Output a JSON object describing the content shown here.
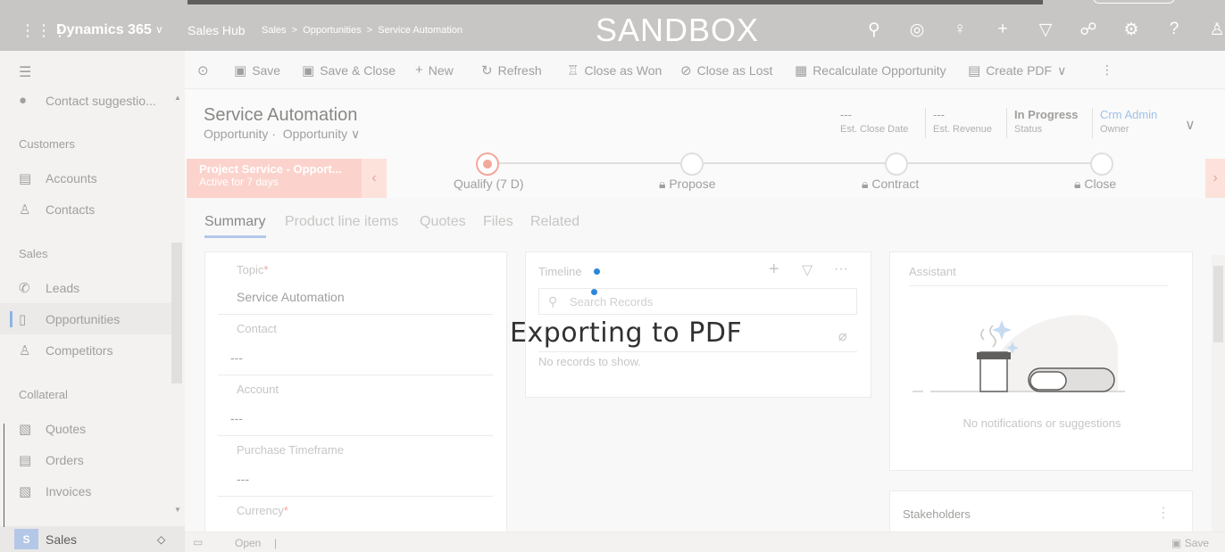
{
  "topbar": {
    "app_name": "Dynamics 365",
    "hub": "Sales Hub",
    "breadcrumb": [
      "Sales",
      "Opportunities",
      "Service Automation"
    ],
    "environment": "SANDBOX",
    "icons": [
      "search-icon",
      "task-icon",
      "lightbulb-icon",
      "plus-icon",
      "filter-icon",
      "assistant-icon",
      "gear-icon",
      "help-icon",
      "user-icon"
    ]
  },
  "sidebar": {
    "top_item": "Contact suggestio...",
    "groups": [
      {
        "label": "Customers",
        "items": [
          "Accounts",
          "Contacts"
        ]
      },
      {
        "label": "Sales",
        "items": [
          "Leads",
          "Opportunities",
          "Competitors"
        ]
      },
      {
        "label": "Collateral",
        "items": [
          "Quotes",
          "Orders",
          "Invoices"
        ]
      }
    ],
    "area_badge": "S",
    "area_name": "Sales"
  },
  "commands": {
    "save": "Save",
    "save_close": "Save & Close",
    "new": "New",
    "refresh": "Refresh",
    "close_won": "Close as Won",
    "close_lost": "Close as Lost",
    "recalculate": "Recalculate Opportunity",
    "create_pdf": "Create PDF"
  },
  "header": {
    "title": "Service Automation",
    "entity": "Opportunity",
    "form": "Opportunity",
    "fields": [
      {
        "value": "---",
        "label": "Est. Close Date"
      },
      {
        "value": "---",
        "label": "Est. Revenue"
      },
      {
        "value": "In Progress",
        "label": "Status"
      },
      {
        "value": "Crm Admin",
        "label": "Owner"
      }
    ]
  },
  "bpf": {
    "process_name": "Project Service - Opport...",
    "active_for": "Active for 7 days",
    "stages": [
      "Qualify  (7 D)",
      "Propose",
      "Contract",
      "Close"
    ]
  },
  "tabs": [
    "Summary",
    "Product line items",
    "Quotes",
    "Files",
    "Related"
  ],
  "summary": {
    "topic_label": "Topic",
    "topic_value": "Service Automation",
    "contact_label": "Contact",
    "contact_value": "---",
    "account_label": "Account",
    "account_value": "---",
    "timeframe_label": "Purchase Timeframe",
    "timeframe_value": "---",
    "currency_label": "Currency"
  },
  "timeline": {
    "title": "Timeline",
    "search_placeholder": "Search Records",
    "empty": "No records to show."
  },
  "assistant": {
    "title": "Assistant",
    "empty": "No notifications or suggestions"
  },
  "stakeholders": {
    "title": "Stakeholders"
  },
  "statusbar": {
    "open": "Open",
    "save": "Save"
  },
  "overlay": "Exporting to PDF"
}
